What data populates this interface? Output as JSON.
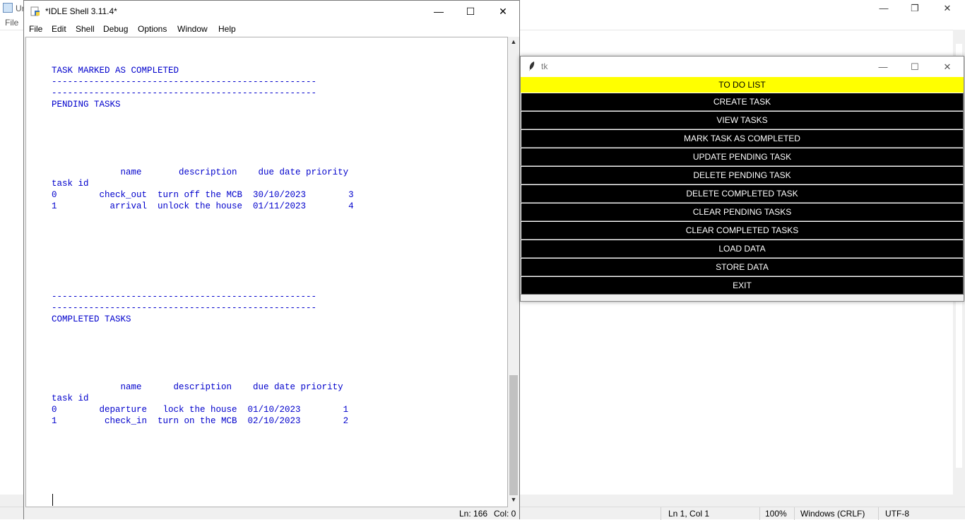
{
  "background_window": {
    "title": "Ur",
    "menu": "File",
    "controls": [
      "—",
      "❐",
      "✕"
    ],
    "status": {
      "position": "Ln 1, Col 1",
      "zoom": "100%",
      "line_endings": "Windows (CRLF)",
      "encoding": "UTF-8"
    }
  },
  "idle": {
    "title": "*IDLE Shell 3.11.4*",
    "controls": [
      "—",
      "☐",
      "✕"
    ],
    "menu": [
      "File",
      "Edit",
      "Shell",
      "Debug",
      "Options",
      "Window",
      "Help"
    ],
    "output": "TASK MARKED AS COMPLETED\n--------------------------------------------------\n--------------------------------------------------\nPENDING TASKS\n\n\n\n\n\n             name       description    due date priority\ntask id\n0        check_out  turn off the MCB  30/10/2023        3\n1          arrival  unlock the house  01/11/2023        4\n\n\n\n\n\n\n\n--------------------------------------------------\n--------------------------------------------------\nCOMPLETED TASKS\n\n\n\n\n\n             name      description    due date priority\ntask id\n0        departure   lock the house  01/10/2023        1\n1         check_in  turn on the MCB  02/10/2023        2\n\n\n\n\n\n\n\n--------------------------------------------------",
    "status": {
      "line": "Ln: 166",
      "col": "Col: 0"
    }
  },
  "tk": {
    "title": "tk",
    "controls": [
      "—",
      "☐",
      "✕"
    ],
    "header": "TO DO LIST",
    "header_color": "#ffff00",
    "buttons": [
      "CREATE TASK",
      "VIEW TASKS",
      "MARK TASK AS COMPLETED",
      "UPDATE PENDING TASK",
      "DELETE PENDING TASK",
      "DELETE COMPLETED TASK",
      "CLEAR PENDING TASKS",
      "CLEAR COMPLETED TASKS",
      "LOAD DATA",
      "STORE DATA",
      "EXIT"
    ]
  }
}
